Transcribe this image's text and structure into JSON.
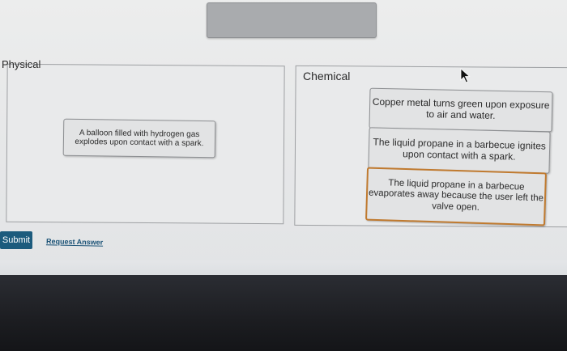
{
  "zones": {
    "physical_label": "Physical",
    "chemical_label": "Chemical"
  },
  "cards": {
    "balloon": "A balloon filled with hydrogen gas explodes upon contact with a spark.",
    "copper": "Copper metal turns green upon exposure to air and water.",
    "propane_ignite": "The liquid propane in a barbecue ignites upon contact with a spark.",
    "propane_evaporate": "The liquid propane in a barbecue evaporates away because the user left the valve open."
  },
  "actions": {
    "submit_label": "Submit",
    "request_answer_label": "Request Answer"
  },
  "colors": {
    "submit_bg": "#1c5b7d",
    "link": "#1a5276",
    "selected_card_border": "#c07a2f"
  }
}
